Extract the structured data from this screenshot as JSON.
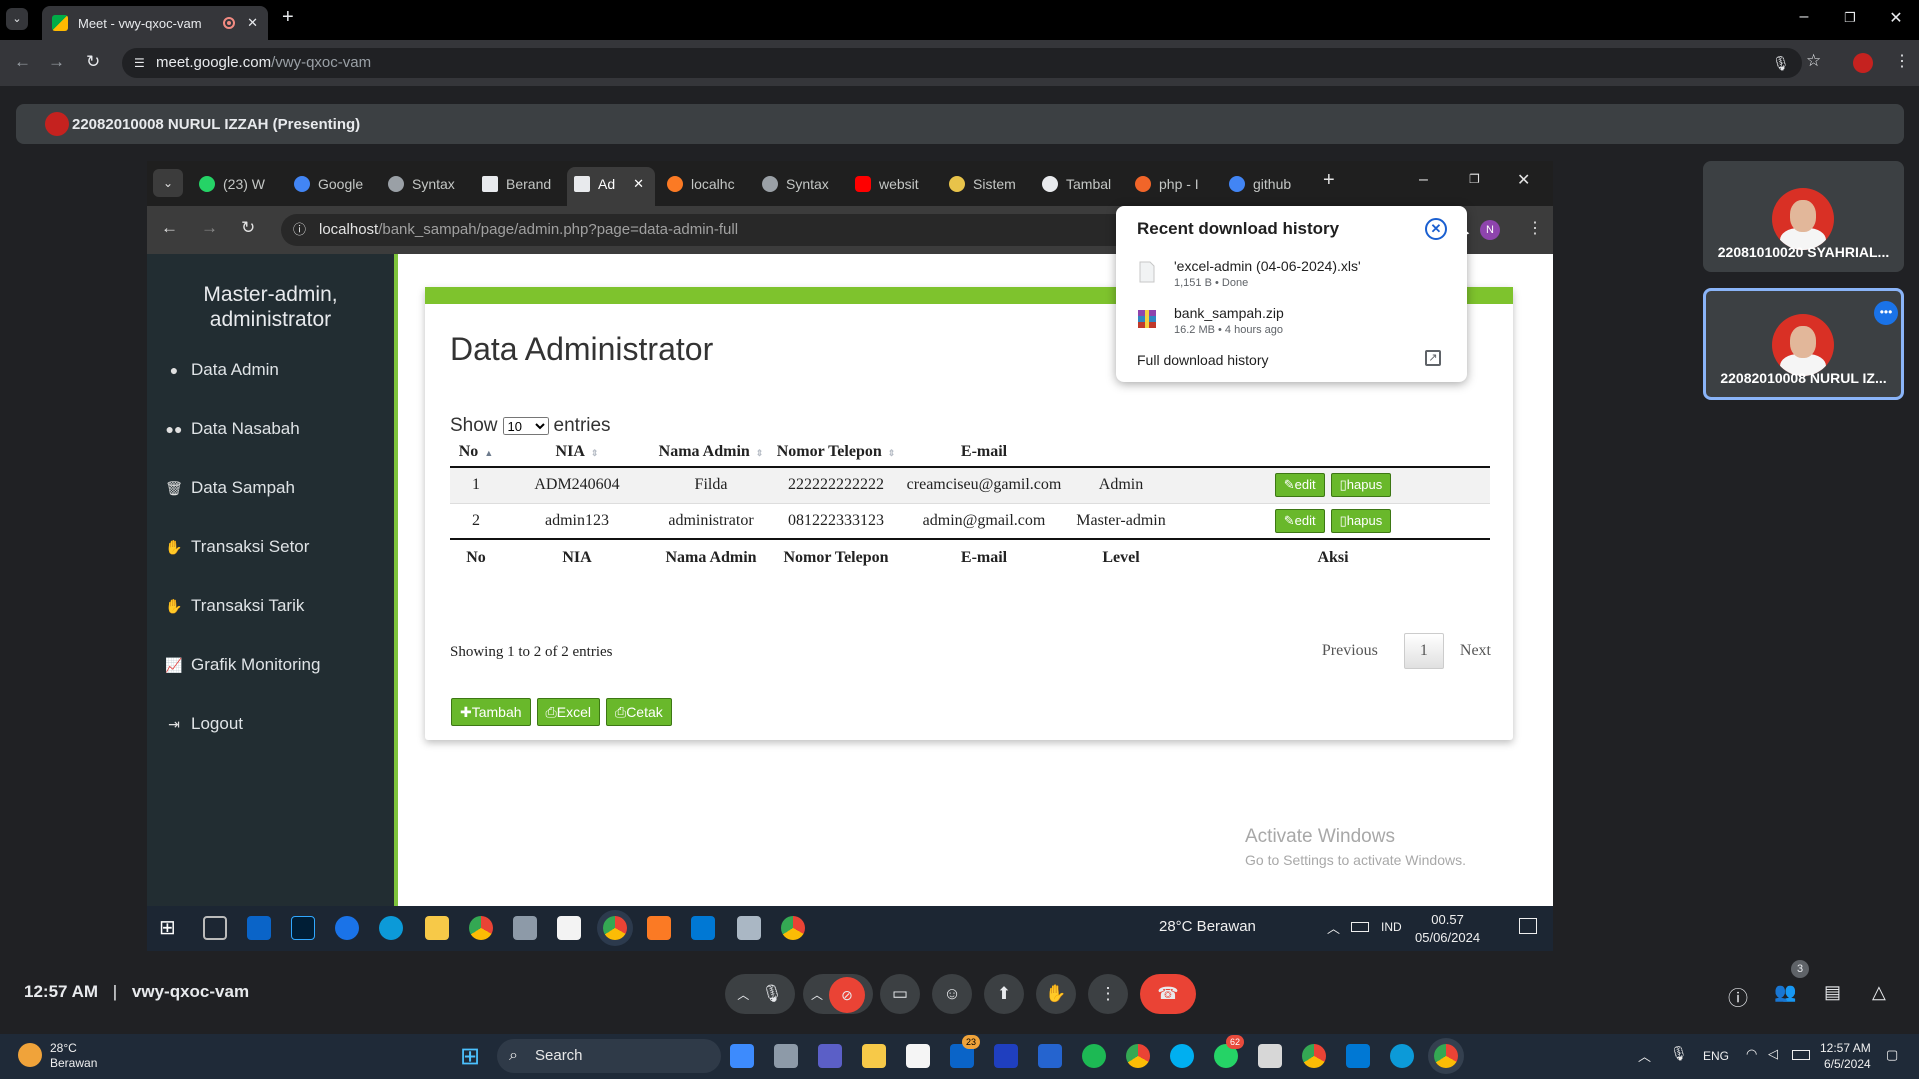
{
  "outer_browser": {
    "tab_title": "Meet - vwy-qxoc-vam",
    "url_host": "meet.google.com",
    "url_path": "/vwy-qxoc-vam"
  },
  "meet": {
    "presenter_label": "22082010008 NURUL IZZAH (Presenting)",
    "participants": [
      {
        "name": "22081010020 SYAHRIAL..."
      },
      {
        "name": "22082010008 NURUL IZ..."
      }
    ],
    "bottom": {
      "time": "12:57 AM",
      "separator": "|",
      "meeting_code": "vwy-qxoc-vam",
      "people_count": "3"
    }
  },
  "inner_browser": {
    "tabs": [
      {
        "label": "(23) W"
      },
      {
        "label": "Google"
      },
      {
        "label": "Syntax"
      },
      {
        "label": "Berand"
      },
      {
        "label": "Ad"
      },
      {
        "label": "localhc"
      },
      {
        "label": "Syntax"
      },
      {
        "label": "websit"
      },
      {
        "label": "Sistem"
      },
      {
        "label": "Tambal"
      },
      {
        "label": "php - I"
      },
      {
        "label": "github"
      }
    ],
    "url_host": "localhost",
    "url_path": "/bank_sampah/page/admin.php?page=data-admin-full",
    "profile_initial": "N"
  },
  "sidebar": {
    "title": "Master-admin, administrator",
    "items": [
      {
        "label": "Data Admin",
        "icon": "user-icon"
      },
      {
        "label": "Data Nasabah",
        "icon": "users-icon"
      },
      {
        "label": "Data Sampah",
        "icon": "trash-icon"
      },
      {
        "label": "Transaksi Setor",
        "icon": "handshake-icon"
      },
      {
        "label": "Transaksi Tarik",
        "icon": "handshake-icon"
      },
      {
        "label": "Grafik Monitoring",
        "icon": "line-chart-icon"
      },
      {
        "label": "Logout",
        "icon": "sign-out-icon"
      }
    ]
  },
  "main": {
    "title": "Data Administrator",
    "show_label": "Show",
    "page_size": "10",
    "entries_label": "entries",
    "columns": [
      "No",
      "NIA",
      "Nama Admin",
      "Nomor Telepon",
      "E-mail",
      "Level",
      "Aksi"
    ],
    "rows": [
      {
        "no": "1",
        "nia": "ADM240604",
        "nama": "Filda",
        "telepon": "222222222222",
        "email": "creamciseu@gamil.com",
        "level": "Admin"
      },
      {
        "no": "2",
        "nia": "admin123",
        "nama": "administrator",
        "telepon": "081222333123",
        "email": "admin@gmail.com",
        "level": "Master-admin"
      }
    ],
    "edit_label": "edit",
    "hapus_label": "hapus",
    "info": "Showing 1 to 2 of 2 entries",
    "previous": "Previous",
    "page": "1",
    "next": "Next",
    "actions": {
      "tambah": "Tambah",
      "excel": "Excel",
      "cetak": "Cetak"
    }
  },
  "downloads": {
    "title": "Recent download history",
    "items": [
      {
        "name": "'excel-admin (04-06-2024).xls'",
        "meta": "1,151 B • Done"
      },
      {
        "name": "bank_sampah.zip",
        "meta": "16.2 MB • 4 hours ago"
      }
    ],
    "full_history": "Full download history"
  },
  "watermark": {
    "title": "Activate Windows",
    "subtitle": "Go to Settings to activate Windows."
  },
  "inner_taskbar": {
    "weather": "28°C  Berawan",
    "lang": "IND",
    "time": "00.57",
    "date": "05/06/2024"
  },
  "win_taskbar": {
    "temp": "28°C",
    "condition": "Berawan",
    "search_placeholder": "Search",
    "lang": "ENG",
    "time": "12:57 AM",
    "date": "6/5/2024",
    "badges": {
      "mail": "23",
      "whatsapp": "62"
    }
  },
  "colors": {
    "accent_green": "#7ec32d",
    "sidebar_bg": "#222d32",
    "hangup_red": "#ea4335"
  }
}
